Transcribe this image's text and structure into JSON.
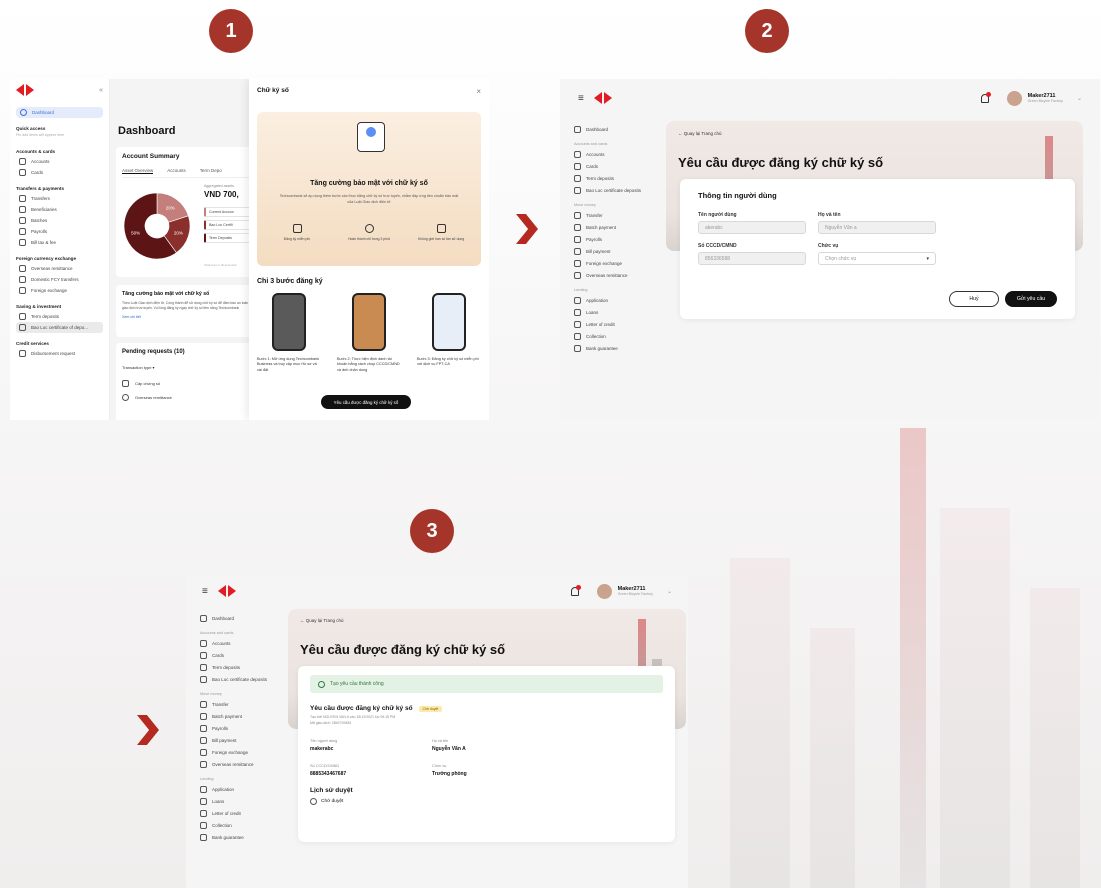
{
  "steps": [
    "1",
    "2",
    "3"
  ],
  "panel1": {
    "sidebar": {
      "dashboard": "Dashboard",
      "quick_access": "Quick access",
      "quick_placeholder": "Pin add items will appear here",
      "groups": [
        {
          "title": "Accounts & cards",
          "items": [
            "Accounts",
            "Cards"
          ]
        },
        {
          "title": "Transfers & payments",
          "items": [
            "Transfers",
            "Beneficiaries",
            "Batches",
            "Payrolls",
            "Bill tax & fee"
          ]
        },
        {
          "title": "Foreign currency exchange",
          "items": [
            "Overseas remittance",
            "Domestic FCY transfers",
            "Foreign exchange"
          ]
        },
        {
          "title": "Saving & investment",
          "items": [
            "Term deposits",
            "Bao Loc certificate of depo..."
          ]
        },
        {
          "title": "Credit services",
          "items": [
            "Disbursement request"
          ]
        }
      ]
    },
    "main": {
      "title": "Dashboard",
      "summary_title": "Account Summary",
      "tabs": [
        "Asset Overview",
        "Accounts",
        "Term Depo"
      ],
      "aggregated": "Aggregated assets",
      "amount": "VND 700,",
      "pie": [
        {
          "label": "20%",
          "value": 20,
          "color": "#c47f7c"
        },
        {
          "label": "20%",
          "value": 20,
          "color": "#8a2f2b"
        },
        {
          "label": "50%",
          "value": 60,
          "color": "#5c1414"
        }
      ],
      "legend": [
        "Current Accoun",
        "Bao Loc Certifi",
        "Term Deposits"
      ],
      "footnote": "Total sum in all accounts",
      "promo_title": "Tăng cường bảo mật với chữ ký số",
      "promo_text": "Theo Luật Giao dịch điện tử, Công thành để sử dụng chữ ký số để đảm bảo an toàn giao dịch trực tuyến. Vui lòng đăng ký ngay chữ ký số tiền năng Techcombank",
      "promo_link": "Xem chi tiết",
      "pending": "Pending requests (10)",
      "filter": "Transaction type",
      "row": "Cấp chứng số",
      "row2": "Overseas remittance"
    },
    "modal": {
      "title": "Chữ ký số",
      "close": "×",
      "hero_title": "Tăng cường bảo mật với chữ ký số",
      "hero_text": "Techcombank sẽ áp dụng thêm bước xác thực bằng chữ ký số trực tuyến, nhằm đáp ứng tiêu chuẩn bảo mật của Luật Giao dịch điện tử",
      "features": [
        {
          "icon": "FREE",
          "text": "Đăng ký miễn phí"
        },
        {
          "icon": "clock",
          "text": "Hoàn thành chỉ trong 3 phút"
        },
        {
          "icon": "doc",
          "text": "Không giới hạn số lần sử dụng"
        }
      ],
      "steps_title": "Chỉ 3 bước đăng ký",
      "steps": [
        "Bước 1: Mở ứng dụng Techcombank Business và truy cập mục Hồ sơ và cài đặt",
        "Bước 2: Thực hiện định danh tài khoản bằng cách chụp CCCD/CMND và ảnh chân dung",
        "Bước 3: Đăng ký chữ ký số miễn phí với dịch vụ FPT-CA"
      ],
      "cta": "Yêu cầu được đăng ký chữ ký số"
    }
  },
  "panel2": {
    "user": {
      "name": "Maker2711",
      "company": "Green Bicycle Factory"
    },
    "sidebar": [
      {
        "type": "item",
        "label": "Dashboard"
      },
      {
        "type": "section",
        "label": "Accounts and cards"
      },
      {
        "type": "item",
        "label": "Accounts"
      },
      {
        "type": "item",
        "label": "Cards"
      },
      {
        "type": "item",
        "label": "Term deposits"
      },
      {
        "type": "item",
        "label": "Bao Loc certificate deposits"
      },
      {
        "type": "section",
        "label": "Move money"
      },
      {
        "type": "item",
        "label": "Transfer"
      },
      {
        "type": "item",
        "label": "Batch payment"
      },
      {
        "type": "item",
        "label": "Payrolls"
      },
      {
        "type": "item",
        "label": "Bill payment"
      },
      {
        "type": "item",
        "label": "Foreign exchange"
      },
      {
        "type": "item",
        "label": "Overseas remittance"
      },
      {
        "type": "section",
        "label": "Lending"
      },
      {
        "type": "item",
        "label": "Application"
      },
      {
        "type": "item",
        "label": "Loans"
      },
      {
        "type": "item",
        "label": "Letter of credit"
      },
      {
        "type": "item",
        "label": "Collection"
      },
      {
        "type": "item",
        "label": "Bank guarantee"
      }
    ],
    "back": "← Quay lại Trang chủ",
    "page_title": "Yêu cầu được đăng ký chữ ký số",
    "card_title": "Thông tin người dùng",
    "fields": [
      {
        "label": "Tên người dùng",
        "value": "akerabc"
      },
      {
        "label": "Họ và tên",
        "value": "Nguyễn Văn a"
      },
      {
        "label": "Số CCCD/CMND",
        "value": "856336588"
      },
      {
        "label": "Chức vụ",
        "value": "Chọn chức vụ"
      }
    ],
    "cancel": "Huỷ",
    "submit": "Gửi yêu cầu"
  },
  "panel3": {
    "success": "Tạo yêu cầu thành công",
    "req_title": "Yêu cầu được đăng ký chữ ký số",
    "badge": "Chờ duyệt",
    "meta1": "Tạo bởi NGUYEN VAN A vào 15/12/2021 lúc 09:15 PM",
    "meta2": "Mã giao dịch: 2840739483",
    "fields": [
      {
        "label": "Tên người dùng",
        "value": "makerabc"
      },
      {
        "label": "Họ và tên",
        "value": "Nguyễn Văn A"
      },
      {
        "label": "Số CCCD/CMND",
        "value": "8885343467687"
      },
      {
        "label": "Chức vụ",
        "value": "Trưởng phòng"
      }
    ],
    "history_title": "Lịch sử duyệt",
    "history_item": "Chờ duyệt"
  },
  "colors": {
    "brand_red": "#e31b23",
    "step_red": "#a5352a",
    "dark_pie": "#5c1414",
    "success_bg": "#e3f2e5"
  }
}
